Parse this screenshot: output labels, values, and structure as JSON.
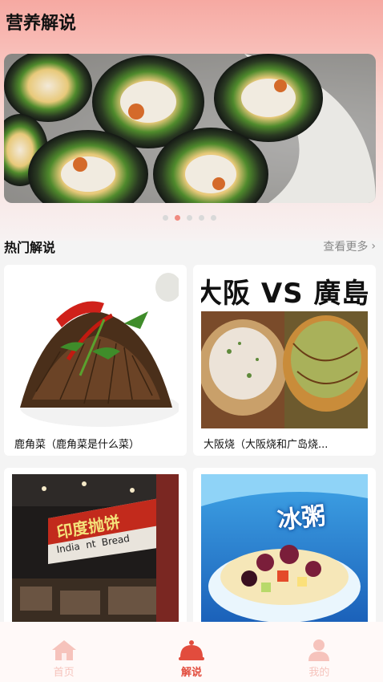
{
  "header": {
    "title": "营养解说"
  },
  "banner": {
    "slide_count": 5,
    "active_index": 1
  },
  "section": {
    "title": "热门解说",
    "more_label": "查看更多",
    "more_icon": "chevron-right-icon"
  },
  "cards": [
    {
      "caption": "鹿角菜（鹿角菜是什么菜）"
    },
    {
      "caption": "大阪烧（大阪烧和广岛烧...",
      "image_text": "大阪 VS 廣島"
    },
    {
      "caption": "",
      "image_text": "印度抛饼",
      "image_subtext": "India  nt  Bread"
    },
    {
      "caption": "",
      "image_text": "冰粥"
    }
  ],
  "nav": {
    "items": [
      {
        "label": "首页",
        "icon": "home-icon"
      },
      {
        "label": "解说",
        "icon": "food-cover-icon",
        "active": true
      },
      {
        "label": "我的",
        "icon": "user-icon"
      }
    ]
  },
  "colors": {
    "accent": "#e24c3d",
    "accent_light": "#f6c3bc",
    "gradient_top": "#f6a9a2"
  }
}
